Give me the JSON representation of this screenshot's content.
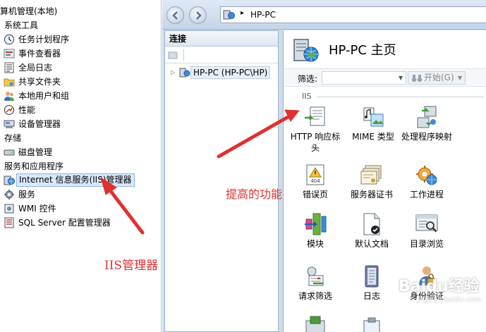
{
  "tree": {
    "root_label": "算机管理(本地)",
    "items": [
      {
        "label": "系统工具",
        "icon": "none",
        "level": 0
      },
      {
        "label": "任务计划程序",
        "icon": "clock-icon",
        "level": 1
      },
      {
        "label": "事件查看器",
        "icon": "event-viewer-icon",
        "level": 1
      },
      {
        "label": "全局日志",
        "icon": "log-icon",
        "level": 1
      },
      {
        "label": "共享文件夹",
        "icon": "shared-folder-icon",
        "level": 1
      },
      {
        "label": "本地用户和组",
        "icon": "users-icon",
        "level": 1
      },
      {
        "label": "性能",
        "icon": "performance-icon",
        "level": 1
      },
      {
        "label": "设备管理器",
        "icon": "device-manager-icon",
        "level": 1
      },
      {
        "label": "存储",
        "icon": "none",
        "level": 0
      },
      {
        "label": "磁盘管理",
        "icon": "disk-icon",
        "level": 1
      },
      {
        "label": "服务和应用程序",
        "icon": "none",
        "level": 0
      },
      {
        "label": "Internet 信息服务(IIS)管理器",
        "icon": "iis-icon",
        "level": 1,
        "selected": true
      },
      {
        "label": "服务",
        "icon": "gear-icon",
        "level": 1
      },
      {
        "label": "WMI 控件",
        "icon": "wmi-icon",
        "level": 1
      },
      {
        "label": "SQL Server 配置管理器",
        "icon": "sql-icon",
        "level": 1
      }
    ]
  },
  "address_bar": {
    "path": "HP-PC",
    "separator": "▸"
  },
  "connections": {
    "header": "连接",
    "node_label": "HP-PC (HP-PC\\HP)"
  },
  "home": {
    "title": "HP-PC 主页",
    "filter_label": "筛选:",
    "start_label": "开始(G)",
    "group_label": "IIS",
    "features": [
      {
        "label": "HTTP 响应标头",
        "icon": "http-headers-icon"
      },
      {
        "label": "MIME 类型",
        "icon": "mime-types-icon"
      },
      {
        "label": "处理程序映射",
        "icon": "handler-mappings-icon"
      },
      {
        "label": "错误页",
        "icon": "error-pages-icon"
      },
      {
        "label": "服务器证书",
        "icon": "server-certificates-icon"
      },
      {
        "label": "工作进程",
        "icon": "worker-processes-icon"
      },
      {
        "label": "模块",
        "icon": "modules-icon"
      },
      {
        "label": "默认文档",
        "icon": "default-document-icon"
      },
      {
        "label": "目录浏览",
        "icon": "directory-browsing-icon"
      },
      {
        "label": "请求筛选",
        "icon": "request-filtering-icon"
      },
      {
        "label": "日志",
        "icon": "logging-icon"
      },
      {
        "label": "身份验证",
        "icon": "authentication-icon"
      }
    ]
  },
  "annotations": {
    "iis_manager": "IIS管理器",
    "features": "提高的功能"
  },
  "watermark": "Baidu经验",
  "watermark_sub": "jingyan.baidu.com",
  "colors": {
    "annotation": "#e03030",
    "selection": "#d9e8fb",
    "window_chrome": "#cfdbe8"
  }
}
